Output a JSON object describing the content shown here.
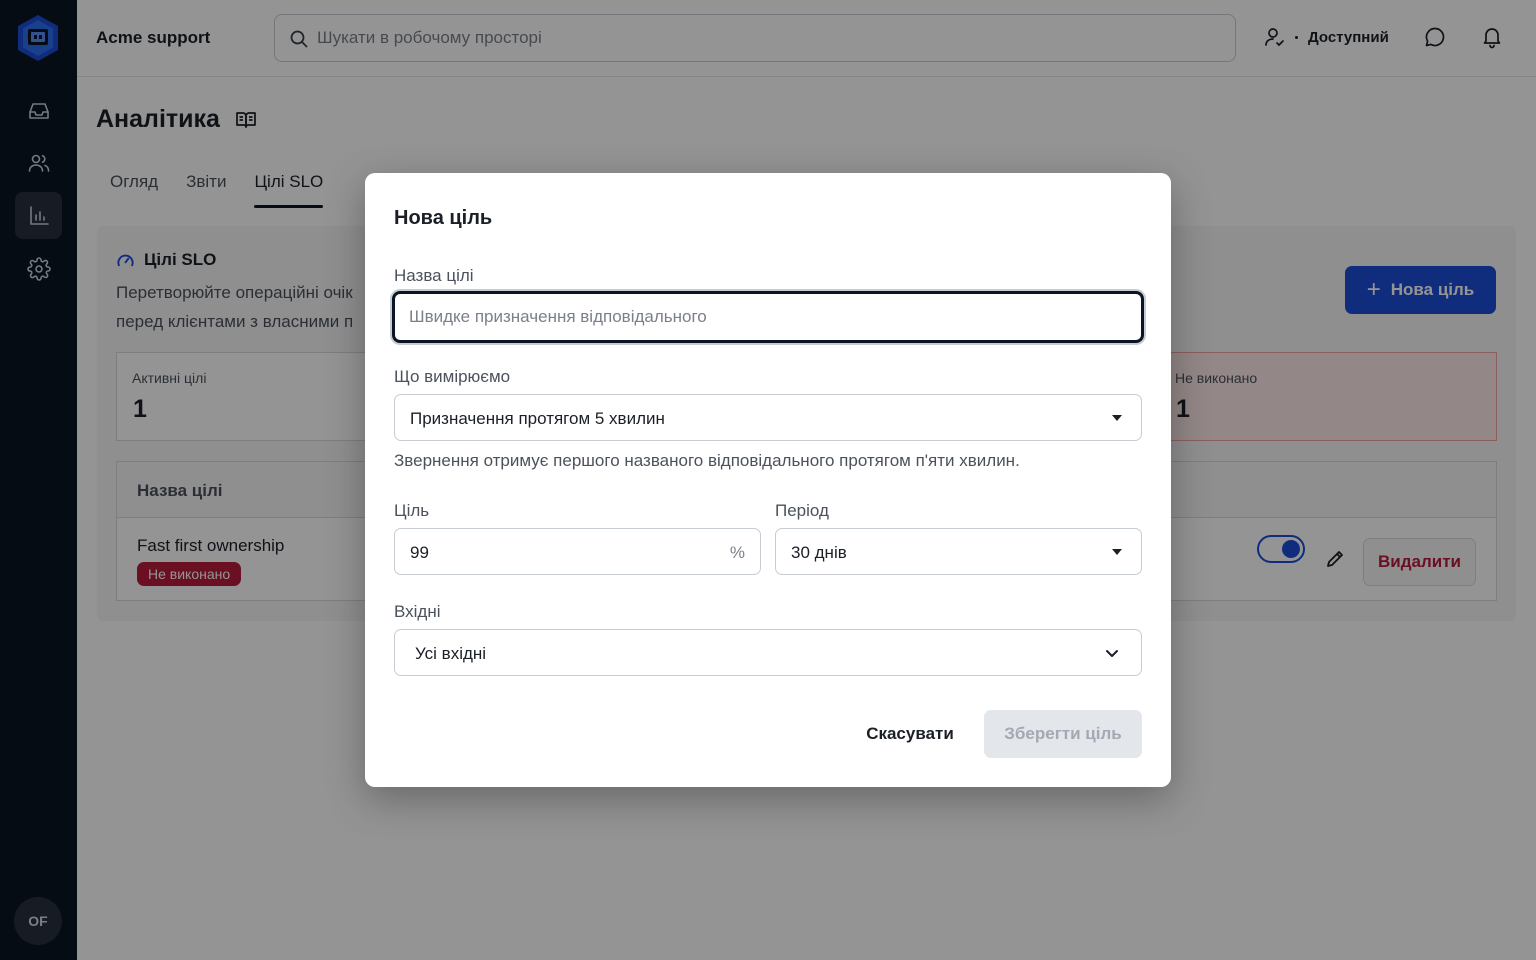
{
  "app": {
    "workspace_name": "Acme support",
    "avatar_initials": "OF"
  },
  "sidebar": {
    "items": [
      {
        "name": "inbox",
        "icon": "inbox-icon"
      },
      {
        "name": "contacts",
        "icon": "users-icon"
      },
      {
        "name": "analytics",
        "icon": "bar-chart-icon",
        "active": true
      },
      {
        "name": "settings",
        "icon": "gear-icon"
      }
    ]
  },
  "header": {
    "search_placeholder": "Шукати в робочому просторі",
    "status_label": "Доступний"
  },
  "page": {
    "title": "Аналітика",
    "tabs": [
      {
        "label": "Огляд"
      },
      {
        "label": "Звіти"
      },
      {
        "label": "Цілі SLO",
        "active": true
      }
    ]
  },
  "slo_card": {
    "title": "Цілі SLO",
    "description_line1": "Перетворюйте операційні очік",
    "description_line2": "перед клієнтами з власними п",
    "new_goal_label": "Нова ціль",
    "stats": [
      {
        "label": "Активні цілі",
        "value": "1"
      },
      {
        "label": "Не виконано",
        "value": "1"
      }
    ],
    "table": {
      "column_name": "Назва цілі",
      "rows": [
        {
          "name": "Fast first ownership",
          "status": "Не виконано",
          "enabled": true,
          "delete_label": "Видалити"
        }
      ]
    }
  },
  "modal": {
    "title": "Нова ціль",
    "name_label": "Назва цілі",
    "name_placeholder": "Швидке призначення відповідального",
    "name_value": "",
    "metric_label": "Що вимірюємо",
    "metric_value": "Призначення протягом 5 хвилин",
    "metric_hint": "Звернення отримує першого названого відповідального протягом п'яти хвилин.",
    "target_label": "Ціль",
    "target_value": "99",
    "target_suffix": "%",
    "period_label": "Період",
    "period_value": "30 днів",
    "inbox_label": "Вхідні",
    "inbox_value": "Усі вхідні",
    "cancel_label": "Скасувати",
    "save_label": "Зберегти ціль",
    "save_disabled": true
  },
  "colors": {
    "primary": "#1d4ed8",
    "danger": "#b91c3c",
    "rail": "#0b1524"
  }
}
